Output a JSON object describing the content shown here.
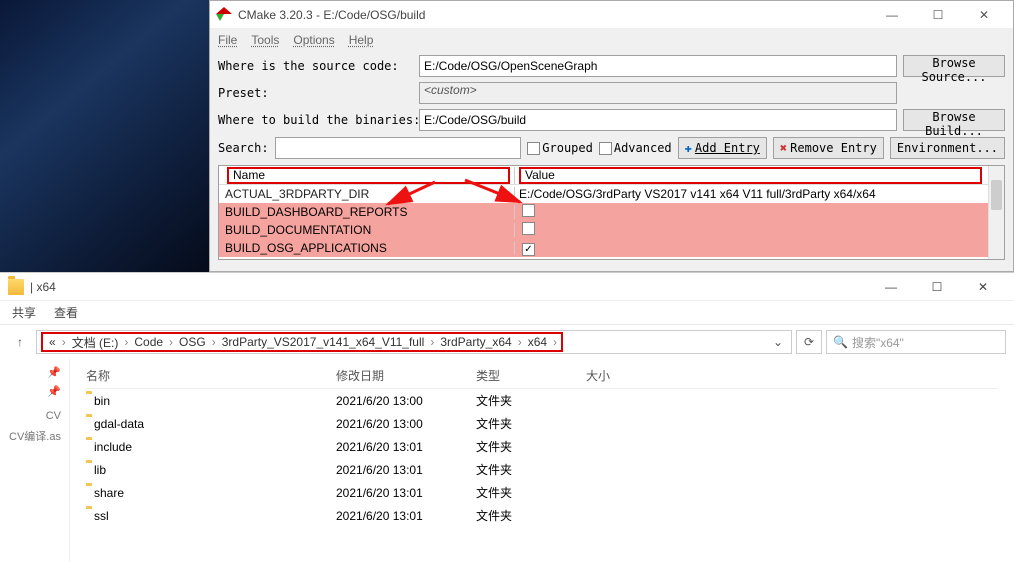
{
  "cmake": {
    "title": "CMake 3.20.3 - E:/Code/OSG/build",
    "menu": {
      "file": "File",
      "tools": "Tools",
      "options": "Options",
      "help": "Help"
    },
    "labels": {
      "source": "Where is the source code:",
      "preset": "Preset:",
      "build": "Where to build the binaries:",
      "search": "Search:",
      "grouped": "Grouped",
      "advanced": "Advanced",
      "add_entry": "Add Entry",
      "remove_entry": "Remove Entry",
      "environment": "Environment..."
    },
    "values": {
      "source": "E:/Code/OSG/OpenSceneGraph",
      "preset": "<custom>",
      "build": "E:/Code/OSG/build"
    },
    "buttons": {
      "browse_source": "Browse Source...",
      "browse_build": "Browse Build..."
    },
    "table": {
      "headers": {
        "name": "Name",
        "value": "Value"
      },
      "rows": [
        {
          "name": "ACTUAL_3RDPARTY_DIR",
          "value": "E:/Code/OSG/3rdParty VS2017 v141 x64 V11 full/3rdParty x64/x64",
          "checked": null,
          "highlight": false
        },
        {
          "name": "BUILD_DASHBOARD_REPORTS",
          "value": "",
          "checked": false,
          "highlight": true
        },
        {
          "name": "BUILD_DOCUMENTATION",
          "value": "",
          "checked": false,
          "highlight": true
        },
        {
          "name": "BUILD_OSG_APPLICATIONS",
          "value": "",
          "checked": true,
          "highlight": true
        }
      ]
    }
  },
  "explorer": {
    "title": "x64",
    "tabs": {
      "share": "共享",
      "view": "查看"
    },
    "breadcrumbs": [
      "«",
      "文档 (E:)",
      "Code",
      "OSG",
      "3rdParty_VS2017_v141_x64_V11_full",
      "3rdParty_x64",
      "x64"
    ],
    "search_placeholder": "搜索\"x64\"",
    "sidebar_items": [
      "CV",
      "CV编译.as"
    ],
    "list_headers": {
      "name": "名称",
      "date": "修改日期",
      "type": "类型",
      "size": "大小"
    },
    "items": [
      {
        "name": "bin",
        "date": "2021/6/20 13:00",
        "type": "文件夹"
      },
      {
        "name": "gdal-data",
        "date": "2021/6/20 13:00",
        "type": "文件夹"
      },
      {
        "name": "include",
        "date": "2021/6/20 13:01",
        "type": "文件夹"
      },
      {
        "name": "lib",
        "date": "2021/6/20 13:01",
        "type": "文件夹"
      },
      {
        "name": "share",
        "date": "2021/6/20 13:01",
        "type": "文件夹"
      },
      {
        "name": "ssl",
        "date": "2021/6/20 13:01",
        "type": "文件夹"
      }
    ]
  }
}
